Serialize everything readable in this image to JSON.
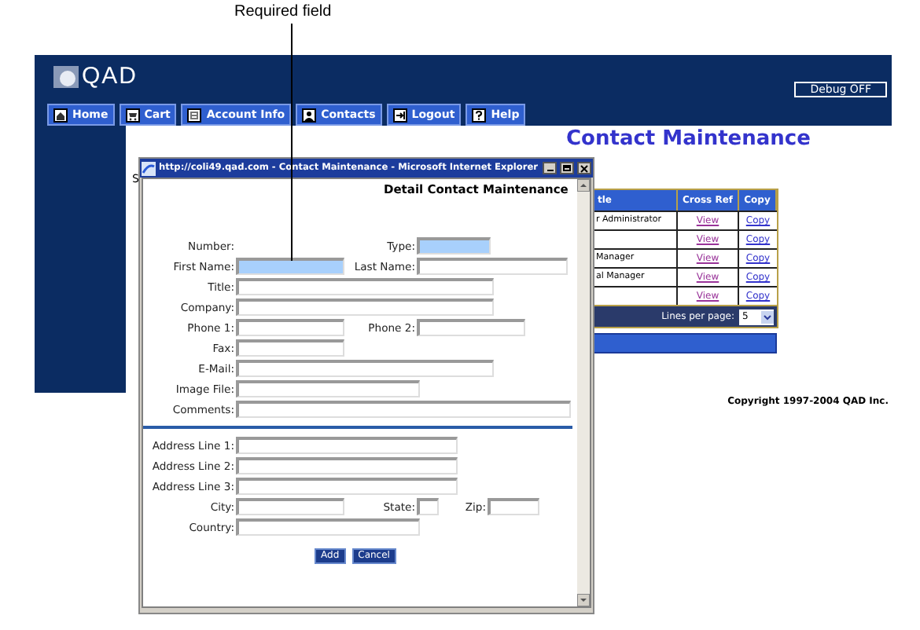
{
  "annotation": {
    "label": "Required field"
  },
  "app": {
    "logo": "QAD",
    "debug_button": "Debug OFF",
    "nav": [
      {
        "label": "Home",
        "kind": "home"
      },
      {
        "label": "Cart",
        "kind": "cart"
      },
      {
        "label": "Account Info",
        "kind": "account"
      },
      {
        "label": "Contacts",
        "kind": "contacts"
      },
      {
        "label": "Logout",
        "kind": "logout"
      },
      {
        "label": "Help",
        "kind": "help"
      }
    ],
    "title": "Contact Maintenance",
    "side_text": "S",
    "table": {
      "columns": [
        "tle",
        "Cross Ref",
        "Copy"
      ],
      "rows": [
        {
          "title": "r Administrator",
          "cross_ref": "View",
          "copy": "Copy"
        },
        {
          "title": "",
          "cross_ref": "View",
          "copy": "Copy"
        },
        {
          "title": "Manager",
          "cross_ref": "View",
          "copy": "Copy"
        },
        {
          "title": "al Manager",
          "cross_ref": "View",
          "copy": "Copy"
        },
        {
          "title": "",
          "cross_ref": "View",
          "copy": "Copy"
        }
      ],
      "lines_label": "Lines per page:",
      "lines_value": "5"
    },
    "copyright": "Copyright 1997-2004 QAD Inc."
  },
  "popup": {
    "title": "http://coli49.qad.com - Contact Maintenance - Microsoft Internet Explorer",
    "heading": "Detail Contact Maintenance",
    "sections": [
      [
        [
          {
            "label": "Number:",
            "kind": "none"
          },
          {
            "label": "Type:",
            "kind": "narrow",
            "required": true
          }
        ],
        [
          {
            "label": "First Name:",
            "kind": "short",
            "required": true
          },
          {
            "label": "Last Name:",
            "kind": "medium",
            "required": false
          }
        ],
        [
          {
            "label": "Title:",
            "kind": "long",
            "required": false
          }
        ],
        [
          {
            "label": "Company:",
            "kind": "long",
            "required": false
          }
        ],
        [
          {
            "label": "Phone 1:",
            "kind": "short",
            "required": false
          },
          {
            "label": "Phone 2:",
            "kind": "short",
            "required": false
          }
        ],
        [
          {
            "label": "Fax:",
            "kind": "short",
            "required": false
          }
        ],
        [
          {
            "label": "E-Mail:",
            "kind": "long",
            "required": false
          }
        ],
        [
          {
            "label": "Image File:",
            "kind": "half",
            "required": false
          }
        ],
        [
          {
            "label": "Comments:",
            "kind": "full",
            "required": false
          }
        ]
      ],
      [
        [
          {
            "label": "Address Line 1:",
            "kind": "wide",
            "required": false
          }
        ],
        [
          {
            "label": "Address Line 2:",
            "kind": "wide",
            "required": false
          }
        ],
        [
          {
            "label": "Address Line 3:",
            "kind": "wide",
            "required": false
          }
        ],
        [
          {
            "label": "City:",
            "kind": "short",
            "required": false
          },
          {
            "label": "State:",
            "kind": "tiny",
            "required": false
          },
          {
            "label": "Zip:",
            "kind": "small",
            "required": false
          }
        ],
        [
          {
            "label": "Country:",
            "kind": "half",
            "required": false
          }
        ]
      ]
    ],
    "buttons": [
      "Add",
      "Cancel"
    ]
  }
}
